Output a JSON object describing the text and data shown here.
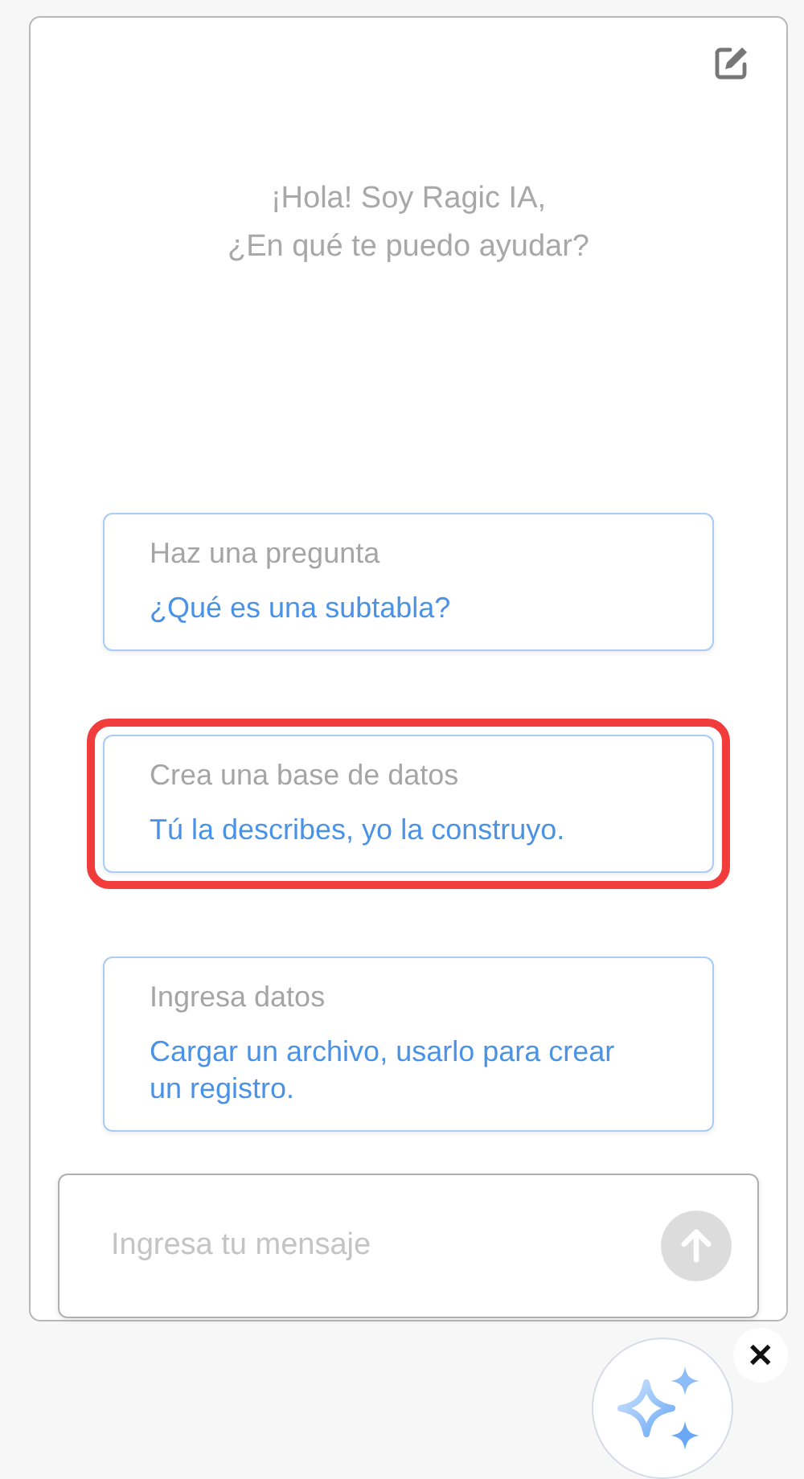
{
  "greeting": [
    "¡Hola! Soy Ragic IA,",
    "¿En qué te puedo ayudar?"
  ],
  "suggestions": [
    {
      "title": "Haz una pregunta",
      "prompt": "¿Qué es una subtabla?",
      "highlighted": false
    },
    {
      "title": "Crea una base de datos",
      "prompt": "Tú la describes, yo la construyo.",
      "highlighted": true
    },
    {
      "title": "Ingresa datos",
      "prompt": "Cargar un archivo, usarlo para crear un registro.",
      "highlighted": false
    }
  ],
  "message_input": {
    "placeholder": "Ingresa tu mensaje"
  },
  "close_label": "✕"
}
